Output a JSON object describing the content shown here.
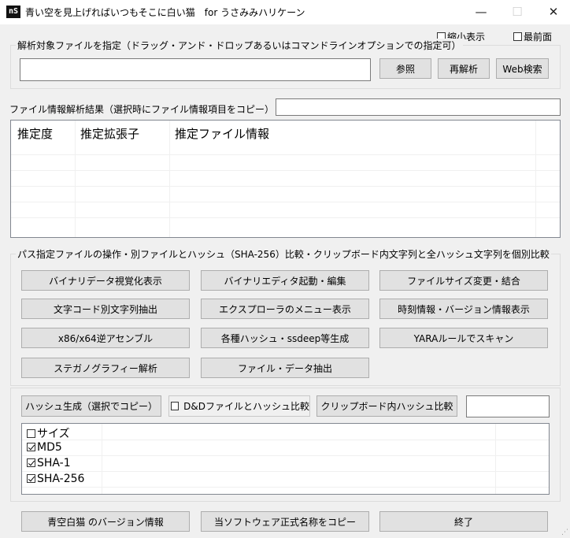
{
  "window": {
    "title": "青い空を見上げればいつもそこに白い猫　for うさみみハリケーン",
    "icon_text": "nS",
    "minimize": "—",
    "maximize": "☐",
    "close": "✕"
  },
  "options": {
    "shrink_label": "縮小表示",
    "shrink_checked": false,
    "topmost_label": "最前面",
    "topmost_checked": false
  },
  "target_file": {
    "group_label": "解析対象ファイルを指定（ドラッグ・アンド・ドロップあるいはコマンドラインオプションでの指定可）",
    "path_value": "",
    "browse_label": "参照",
    "reanalyze_label": "再解析",
    "websearch_label": "Web検索"
  },
  "analysis": {
    "label": "ファイル情報解析結果（選択時にファイル情報項目をコピー）",
    "copy_field_value": "",
    "columns": [
      "推定度",
      "推定拡張子",
      "推定ファイル情報"
    ],
    "rows": []
  },
  "operations": {
    "group_label": "パス指定ファイルの操作・別ファイルとハッシュ（SHA-256）比較・クリップボード内文字列と全ハッシュ文字列を個別比較",
    "buttons": [
      "バイナリデータ視覚化表示",
      "バイナリエディタ起動・編集",
      "ファイルサイズ変更・結合",
      "文字コード別文字列抽出",
      "エクスプローラのメニュー表示",
      "時刻情報・バージョン情報表示",
      "x86/x64逆アセンブル",
      "各種ハッシュ・ssdeep等生成",
      "YARAルールでスキャン",
      "ステガノグラフィー解析",
      "ファイル・データ抽出"
    ]
  },
  "hash": {
    "generate_label": "ハッシュ生成（選択でコピー）",
    "dd_compare_label": "D&Dファイルとハッシュ比較",
    "dd_compare_checked": false,
    "clipboard_compare_label": "クリップボード内ハッシュ比較",
    "clipboard_field_value": "",
    "items": [
      {
        "label": "サイズ",
        "checked": false
      },
      {
        "label": "MD5",
        "checked": true
      },
      {
        "label": "SHA-1",
        "checked": true
      },
      {
        "label": "SHA-256",
        "checked": true
      }
    ]
  },
  "footer": {
    "version_label": "青空白猫 のバージョン情報",
    "copy_name_label": "当ソフトウェア正式名称をコピー",
    "exit_label": "終了"
  }
}
